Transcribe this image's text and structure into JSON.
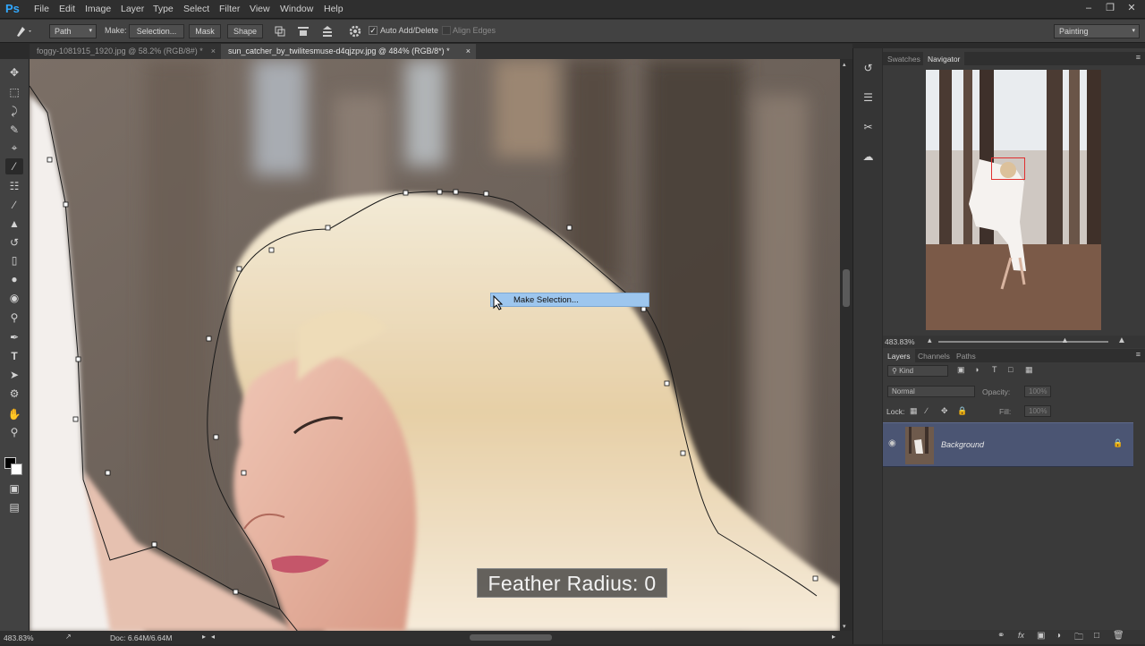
{
  "app": {
    "logo": "Ps"
  },
  "menu": [
    "File",
    "Edit",
    "Image",
    "Layer",
    "Type",
    "Select",
    "Filter",
    "View",
    "Window",
    "Help"
  ],
  "window_controls": [
    "minimize-icon",
    "restore-icon",
    "close-icon"
  ],
  "options_bar": {
    "tool_mode": "Path",
    "make_label": "Make:",
    "selection_button": "Selection...",
    "mask_button": "Mask",
    "shape_button": "Shape",
    "auto_add_delete_label": "Auto Add/Delete",
    "auto_add_delete_checked": true,
    "align_edges_label": "Align Edges",
    "align_edges_checked": false,
    "workspace": "Painting"
  },
  "document_tabs": [
    {
      "label": "foggy-1081915_1920.jpg @ 58.2% (RGB/8#) *",
      "active": false
    },
    {
      "label": "sun_catcher_by_twilitesmuse-d4qjzpv.jpg @ 484% (RGB/8*) *",
      "active": true
    }
  ],
  "tools": [
    "move-icon",
    "marquee-icon",
    "lasso-icon",
    "quick-selection-icon",
    "crop-icon",
    "eyedropper-icon",
    "healing-brush-icon",
    "brush-icon",
    "clone-stamp-icon",
    "history-brush-icon",
    "eraser-icon",
    "paint-bucket-icon",
    "dodge-icon",
    "pen-icon",
    "type-icon",
    "path-selection-icon",
    "rectangle-shape-icon",
    "hand-icon",
    "zoom-icon",
    "foreground-background-colors",
    "quick-mask-icon",
    "screen-mode-icon"
  ],
  "context_menu": {
    "item": "Make Selection..."
  },
  "overlay": {
    "text": "Feather Radius: 0"
  },
  "status_bar": {
    "zoom": "483.83%",
    "doc": "Doc: 6.64M/6.64M"
  },
  "navigator": {
    "tabs": [
      "Swatches",
      "Navigator"
    ],
    "active_tab": "Navigator",
    "zoom": "483.83%"
  },
  "layers_panel": {
    "tabs": [
      "Layers",
      "Channels",
      "Paths"
    ],
    "active_tab": "Layers",
    "filter_kind": "Kind",
    "blend_mode": "Normal",
    "opacity_label": "Opacity:",
    "opacity_value": "100%",
    "lock_label": "Lock:",
    "fill_label": "Fill:",
    "fill_value": "100%",
    "layers": [
      {
        "name": "Background",
        "visible": true,
        "locked": true
      }
    ]
  },
  "colors": {
    "accent": "#31a8ff",
    "selected_layer": "#4b5573",
    "context_highlight": "#9dc6ee",
    "nav_frame": "#e03030"
  }
}
